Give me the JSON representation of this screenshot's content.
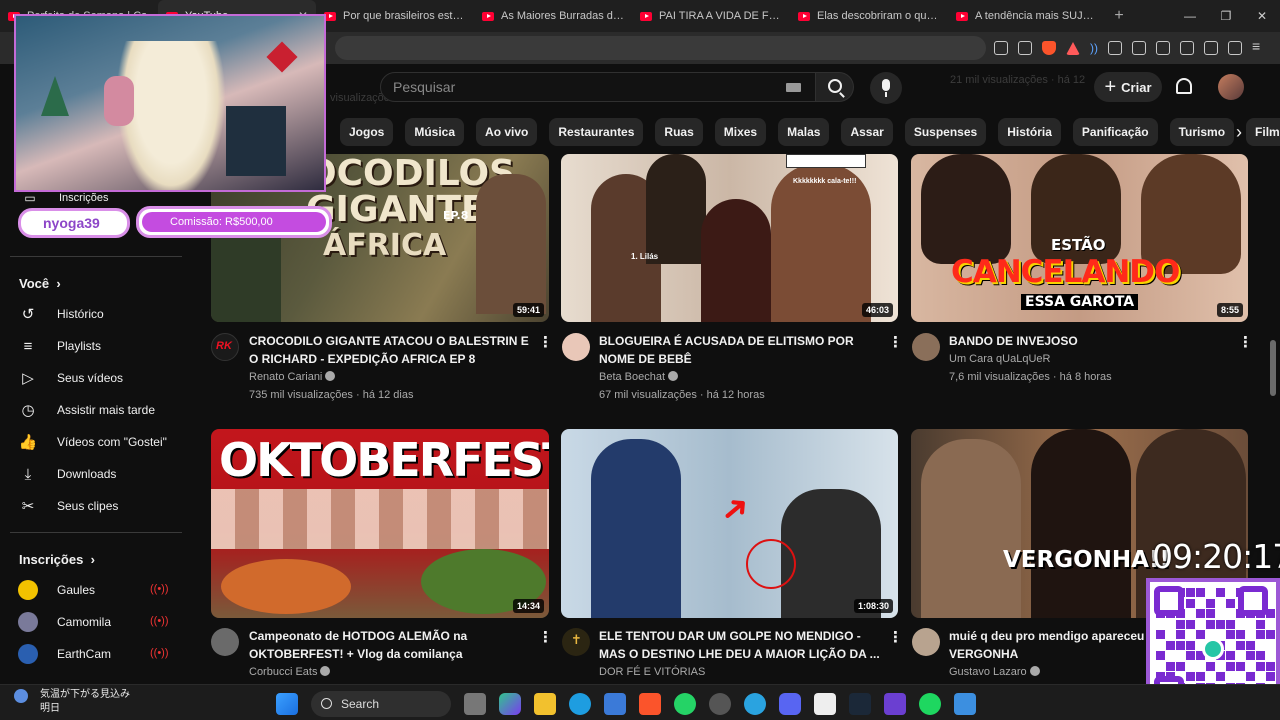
{
  "browser": {
    "tabs": [
      {
        "title": "Perfeito de Semana | Ca",
        "active": false
      },
      {
        "title": "YouTube",
        "active": true
      },
      {
        "title": "Por que brasileiros estão de",
        "active": false
      },
      {
        "title": "As Maiores Burradas de Bra",
        "active": false
      },
      {
        "title": "PAI TIRA A VIDA DE FILHO A",
        "active": false
      },
      {
        "title": "Elas descobriram o que HO",
        "active": false
      },
      {
        "title": "A tendência mais SUJA da in",
        "active": false
      }
    ],
    "new_tab": "+",
    "close": "✕",
    "window_controls": [
      "—",
      "❐",
      "✕"
    ]
  },
  "header": {
    "search_placeholder": "Pesquisar",
    "create_label": "Criar",
    "create_plus": "+",
    "ghost_line1": "21 mil visualizações · há 12",
    "ghost_line2": "visualizações · há 8"
  },
  "chips": [
    "Jogos",
    "Música",
    "Ao vivo",
    "Restaurantes",
    "Ruas",
    "Mixes",
    "Malas",
    "Assar",
    "Suspenses",
    "História",
    "Panificação",
    "Turismo",
    "Filmes"
  ],
  "chip_next": "›",
  "sidebar": {
    "subscriptions_top": "Inscrições",
    "you_heading": "Você",
    "you_items": [
      {
        "label": "Histórico",
        "icon": "history-icon",
        "glyph": "↺"
      },
      {
        "label": "Playlists",
        "icon": "playlist-icon",
        "glyph": "≡"
      },
      {
        "label": "Seus vídeos",
        "icon": "your-videos-icon",
        "glyph": "▷"
      },
      {
        "label": "Assistir mais tarde",
        "icon": "clock-icon",
        "glyph": "◷"
      },
      {
        "label": "Vídeos com \"Gostei\"",
        "icon": "like-icon",
        "glyph": "👍"
      },
      {
        "label": "Downloads",
        "icon": "download-icon",
        "glyph": "⤓"
      },
      {
        "label": "Seus clipes",
        "icon": "scissors-icon",
        "glyph": "✂"
      }
    ],
    "subs_heading": "Inscrições",
    "channels": [
      {
        "label": "Gaules",
        "color": "#f2c200"
      },
      {
        "label": "Camomila",
        "color": "#7a7a9a"
      },
      {
        "label": "EarthCam",
        "color": "#2a5fb0"
      }
    ],
    "chevron": "›"
  },
  "videos": [
    {
      "title": "CROCODILO GIGANTE ATACOU O BALESTRIN E O RICHARD - EXPEDIÇÃO AFRICA EP 8",
      "channel": "Renato Cariani",
      "stats": "735 mil visualizações · há 12 dias",
      "duration": "59:41",
      "verified": true,
      "thumb_text": "OCODILOS\nGIGANTES",
      "thumb_sub": "ÁFRICA",
      "thumb_ep": "EP.8"
    },
    {
      "title": "BLOGUEIRA É ACUSADA DE ELITISMO POR NOME DE BEBÊ",
      "channel": "Beta Boechat",
      "stats": "67 mil visualizações · há 12 horas",
      "duration": "46:03",
      "verified": true,
      "thumb_caption": "Kkkkkkkk cala-te!!!",
      "thumb_label": "1. Lilás"
    },
    {
      "title": "BANDO DE INVEJOSO",
      "channel": "Um Cara qUaLqUeR",
      "stats": "7,6 mil visualizações · há 8 horas",
      "duration": "8:55",
      "verified": false,
      "thumb_top": "ESTÃO",
      "thumb_mid": "CANCELANDO",
      "thumb_bot": "ESSA GAROTA"
    },
    {
      "title": "Campeonato de HOTDOG ALEMÃO na OKTOBERFEST! + Vlog da comilança",
      "channel": "Corbucci Eats",
      "stats": "",
      "duration": "14:34",
      "verified": true,
      "thumb_text": "OKTOBERFEST"
    },
    {
      "title": "ELE TENTOU DAR UM GOLPE NO MENDIGO - MAS O DESTINO LHE DEU A MAIOR LIÇÃO DA ...",
      "channel": "DOR FÉ E VITÓRIAS",
      "stats": "",
      "duration": "1:08:30",
      "verified": false
    },
    {
      "title": "muié q deu pro mendigo apareceu VERGONHA",
      "channel": "Gustavo Lazaro",
      "stats": "",
      "duration": "",
      "verified": true,
      "thumb_text": "VERGONHA!!"
    }
  ],
  "overlay": {
    "username": "nyoga39",
    "price": "Comissão: R$500,00",
    "clock": "09:20:17"
  },
  "taskbar": {
    "weather_line1": "気温が下がる見込み",
    "weather_line2": "明日",
    "search_label": "Search"
  },
  "colors": {
    "youtube_red": "#ff0033",
    "overlay_purple": "#c44ce0",
    "live_red": "#e33333"
  }
}
